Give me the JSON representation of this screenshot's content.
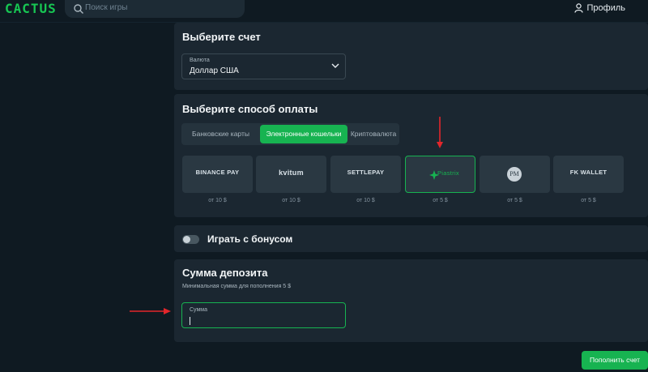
{
  "header": {
    "logo": "CACTUS",
    "search_placeholder": "Поиск игры",
    "profile_label": "Профиль"
  },
  "account": {
    "title": "Выберите счет",
    "currency_label": "Валюта",
    "currency_value": "Доллар США"
  },
  "payment": {
    "title": "Выберите способ оплаты",
    "tabs": [
      {
        "label": "Банковские карты",
        "active": false
      },
      {
        "label": "Электронные кошельки",
        "active": true
      },
      {
        "label": "Криптовалюта",
        "active": false
      }
    ],
    "methods": [
      {
        "name": "BINANCE PAY",
        "min": "от 10 $"
      },
      {
        "name": "kvitum",
        "min": "от 10 $"
      },
      {
        "name": "SETTLEPAY",
        "min": "от 10 $"
      },
      {
        "name": "Piastrix",
        "min": "от 5 $"
      },
      {
        "name": "PM",
        "min": "от 5 $"
      },
      {
        "name": "FK WALLET",
        "min": "от 5 $"
      }
    ]
  },
  "bonus": {
    "label": "Играть с бонусом",
    "enabled": false
  },
  "deposit": {
    "title": "Сумма депозита",
    "subtitle": "Минимальная сумма для пополнения 5 $",
    "amount_label": "Сумма"
  },
  "submit_label": "Пополнить счет",
  "colors": {
    "accent": "#17b351",
    "annotation_arrow": "#e3262b"
  }
}
